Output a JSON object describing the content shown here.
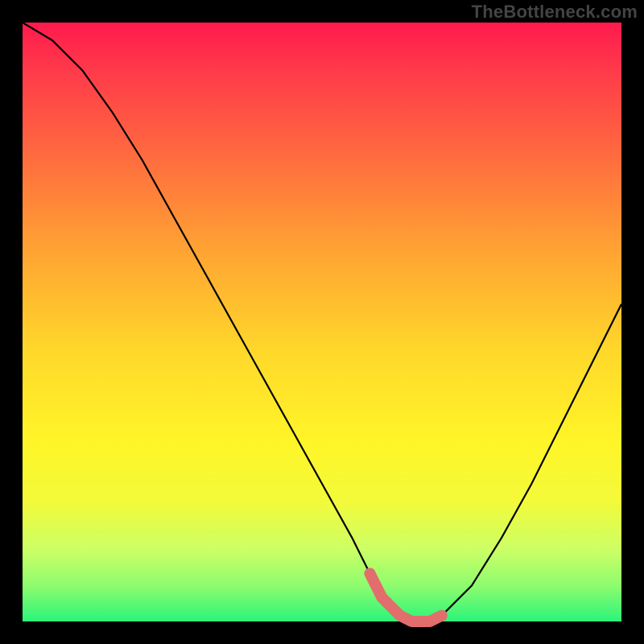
{
  "watermark": {
    "text": "TheBottleneck.com"
  },
  "chart_data": {
    "type": "line",
    "title": "",
    "xlabel": "",
    "ylabel": "",
    "xlim": [
      0,
      100
    ],
    "ylim": [
      0,
      100
    ],
    "grid": false,
    "legend": false,
    "background_gradient": {
      "direction": "vertical_top_to_bottom",
      "stops": [
        {
          "pos": 0,
          "color": "#ff1a4d"
        },
        {
          "pos": 55,
          "color": "#ffd82a"
        },
        {
          "pos": 100,
          "color": "#2bf47a"
        }
      ]
    },
    "series": [
      {
        "name": "bottleneck-curve",
        "color": "#000000",
        "x": [
          0,
          5,
          10,
          15,
          20,
          25,
          30,
          35,
          40,
          45,
          50,
          55,
          58,
          60,
          63,
          65,
          68,
          70,
          75,
          80,
          85,
          90,
          95,
          100
        ],
        "y": [
          100,
          97,
          92,
          85,
          77,
          68,
          59,
          50,
          41,
          32,
          23,
          14,
          8,
          4,
          1,
          0,
          0,
          1,
          6,
          14,
          23,
          33,
          43,
          53
        ]
      }
    ],
    "highlight": {
      "name": "optimal-range",
      "color": "#e26d6d",
      "x": [
        58,
        60,
        63,
        65,
        68,
        70
      ],
      "y": [
        8,
        4,
        1,
        0,
        0,
        1
      ],
      "marker_at": {
        "x": 58,
        "y": 8
      }
    }
  }
}
